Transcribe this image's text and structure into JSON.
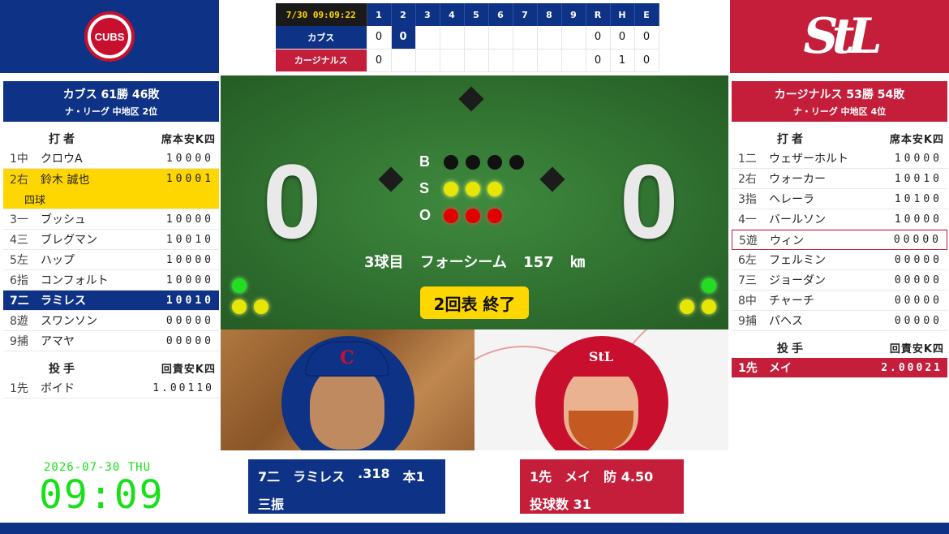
{
  "colors": {
    "cubs": "#0e3386",
    "cardinals": "#c41e3a",
    "highlight": "#ffd700",
    "clock": "#18e018"
  },
  "logos": {
    "home_left": "CUBS",
    "home_right": "StL"
  },
  "linescore": {
    "time": "7/30 09:09:22",
    "headers": [
      "1",
      "2",
      "3",
      "4",
      "5",
      "6",
      "7",
      "8",
      "9",
      "R",
      "H",
      "E"
    ],
    "rows": [
      {
        "team": "カブス",
        "innings": [
          "0",
          "0",
          "",
          "",
          "",
          "",
          "",
          "",
          ""
        ],
        "r": "0",
        "h": "0",
        "e": "0"
      },
      {
        "team": "カージナルス",
        "innings": [
          "0",
          "",
          "",
          "",
          "",
          "",
          "",
          "",
          ""
        ],
        "r": "0",
        "h": "1",
        "e": "0"
      }
    ]
  },
  "left": {
    "record": "カブス 61勝 46敗",
    "league": "ナ・リーグ 中地区 2位",
    "batters_label": "打者",
    "batters_cols": "席本安K四",
    "batters": [
      {
        "pos": "1中",
        "name": "クロウA",
        "stats": "10000"
      },
      {
        "pos": "2右",
        "name": "鈴木 誠也",
        "stats": "10001",
        "note": "四球"
      },
      {
        "pos": "3一",
        "name": "ブッシュ",
        "stats": "10000"
      },
      {
        "pos": "4三",
        "name": "ブレグマン",
        "stats": "10010"
      },
      {
        "pos": "5左",
        "name": "ハップ",
        "stats": "10000"
      },
      {
        "pos": "6指",
        "name": "コンフォルト",
        "stats": "10000"
      },
      {
        "pos": "7二",
        "name": "ラミレス",
        "stats": "10010"
      },
      {
        "pos": "8遊",
        "name": "スワンソン",
        "stats": "00000"
      },
      {
        "pos": "9捕",
        "name": "アマヤ",
        "stats": "00000"
      }
    ],
    "pitchers_label": "投手",
    "pitchers_cols": "回責安K四",
    "pitchers": [
      {
        "pos": "1先",
        "name": "ボイド",
        "stats": "1.00110"
      }
    ]
  },
  "right": {
    "record": "カージナルス 53勝 54敗",
    "league": "ナ・リーグ 中地区 4位",
    "batters_label": "打者",
    "batters_cols": "席本安K四",
    "batters": [
      {
        "pos": "1二",
        "name": "ウェザーホルト",
        "stats": "10000"
      },
      {
        "pos": "2右",
        "name": "ウォーカー",
        "stats": "10010"
      },
      {
        "pos": "3指",
        "name": "ヘレーラ",
        "stats": "10100"
      },
      {
        "pos": "4一",
        "name": "バールソン",
        "stats": "10000"
      },
      {
        "pos": "5遊",
        "name": "ウィン",
        "stats": "00000"
      },
      {
        "pos": "6左",
        "name": "フェルミン",
        "stats": "00000"
      },
      {
        "pos": "7三",
        "name": "ジョーダン",
        "stats": "00000"
      },
      {
        "pos": "8中",
        "name": "チャーチ",
        "stats": "00000"
      },
      {
        "pos": "9捕",
        "name": "パヘス",
        "stats": "00000"
      }
    ],
    "pitchers_label": "投手",
    "pitchers_cols": "回責安K四",
    "pitchers": [
      {
        "pos": "1先",
        "name": "メイ",
        "stats": "2.00021"
      }
    ]
  },
  "field": {
    "away_score": "0",
    "home_score": "0",
    "bso_labels": [
      "B",
      "S",
      "O"
    ],
    "count": {
      "balls": 0,
      "strikes": 3,
      "outs": 3
    },
    "pitch_no": "3球目",
    "pitch_type": "フォーシーム",
    "pitch_speed": "157 ㎞",
    "status": "2回表 終了"
  },
  "clock": {
    "date": "2026-07-30 THU",
    "time": "09:09"
  },
  "batter_card": {
    "pos": "7二",
    "name": "ラミレス",
    "avg": ".318",
    "hr": "本1",
    "result": "三振"
  },
  "pitcher_card": {
    "pos": "1先",
    "name": "メイ",
    "era": "防 4.50",
    "pitches": "投球数 31"
  },
  "photo_marks": {
    "cubs_cap": "C",
    "cards_cap": "StL"
  }
}
